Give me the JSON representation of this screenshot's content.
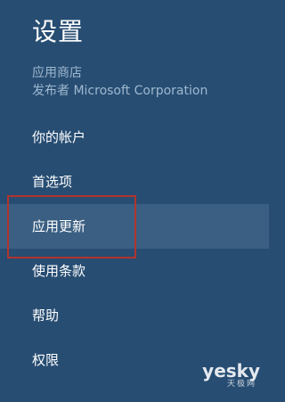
{
  "settings": {
    "title": "设置",
    "app_name": "应用商店",
    "publisher": "发布者 Microsoft Corporation"
  },
  "menu": {
    "items": [
      {
        "label": "你的帐户",
        "selected": false
      },
      {
        "label": "首选项",
        "selected": false
      },
      {
        "label": "应用更新",
        "selected": true
      },
      {
        "label": "使用条款",
        "selected": false
      },
      {
        "label": "帮助",
        "selected": false
      },
      {
        "label": "权限",
        "selected": false
      }
    ]
  },
  "watermark": {
    "brand": "yesky",
    "sub": "天极网"
  },
  "colors": {
    "background": "#274d72",
    "selected_background": "#3a5f82",
    "subtitle_text": "#9fb8d0",
    "highlight_border": "#b1342e",
    "text": "#ffffff"
  }
}
